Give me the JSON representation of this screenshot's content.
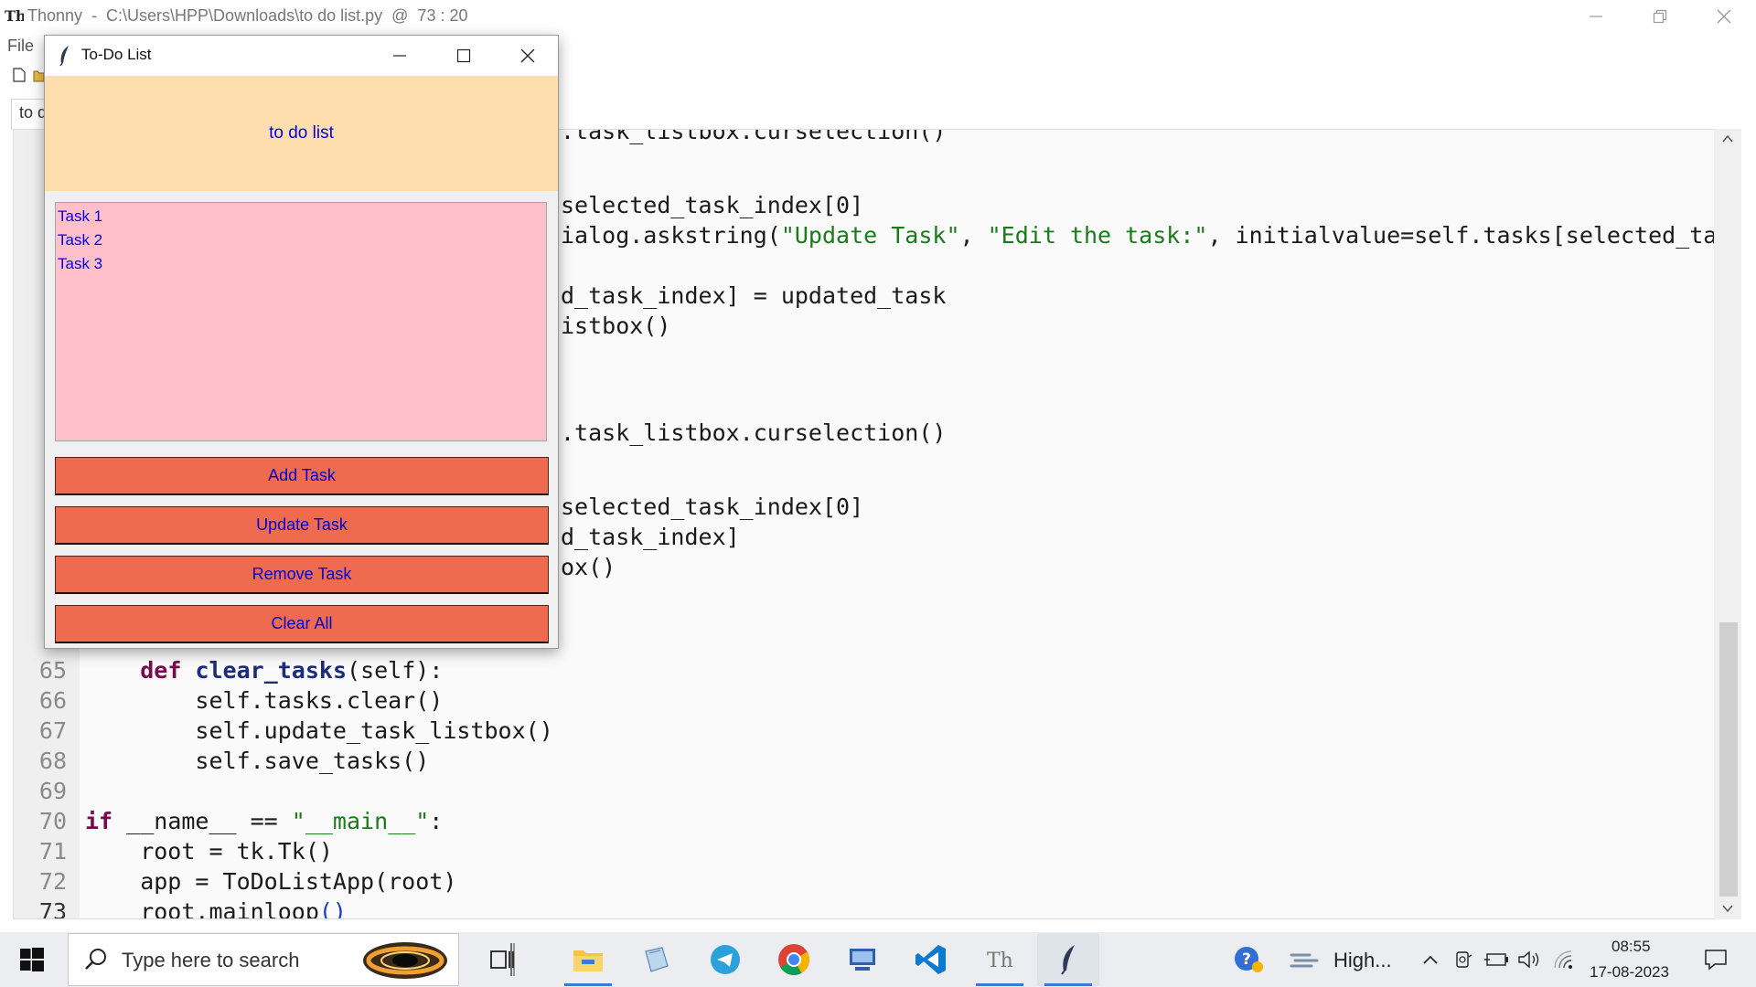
{
  "thonny": {
    "title": "Thonny  -  C:\\Users\\HPP\\Downloads\\to do list.py  @  73 : 20",
    "menu_file": "File",
    "tab_label": "to d"
  },
  "editor": {
    "visible_fragments": [
      ".task_listbox.curselection()",
      "selected_task_index[0]",
      "ialog.askstring(",
      "\"Update Task\"",
      "\"Edit the task:\"",
      ", initialvalue=self.tasks[selected_tas",
      "d_task_index] = updated_task",
      "istbox()",
      ".task_listbox.curselection()",
      "selected_task_index[0]",
      "d_task_index]",
      "ox()"
    ],
    "lines": [
      {
        "num": "65",
        "indent": "    ",
        "kw": "def",
        "fn": "clear_tasks",
        "rest": "(self):"
      },
      {
        "num": "66",
        "text": "        self.tasks.clear()"
      },
      {
        "num": "67",
        "text": "        self.update_task_listbox()"
      },
      {
        "num": "68",
        "text": "        self.save_tasks()"
      },
      {
        "num": "69",
        "text": ""
      },
      {
        "num": "70",
        "kw": "if",
        "mid": " __name__ == ",
        "str": "\"__main__\"",
        "rest": ":"
      },
      {
        "num": "71",
        "text": "    root = tk.Tk()"
      },
      {
        "num": "72",
        "text": "    app = ToDoListApp(root)"
      },
      {
        "num": "73",
        "text": "    root.mainloop",
        "paren": "()"
      }
    ]
  },
  "todo_window": {
    "title": "To-Do List",
    "header_label": "to do list",
    "tasks": [
      "Task 1",
      "Task 2",
      "Task 3"
    ],
    "buttons": {
      "add": "Add Task",
      "update": "Update Task",
      "remove": "Remove Task",
      "clear": "Clear All"
    },
    "colors": {
      "header_bg": "#ffdead",
      "listbox_bg": "#ffc0cb",
      "button_bg": "#ef6b50",
      "text": "#0000ee"
    }
  },
  "taskbar": {
    "search_placeholder": "Type here to search",
    "tray_label": "High...",
    "time": "08:55",
    "date": "17-08-2023",
    "icons": [
      "windows-start-icon",
      "search-icon",
      "task-view-icon",
      "file-explorer-icon",
      "notepad-icon",
      "telegram-icon",
      "chrome-icon",
      "remote-desktop-icon",
      "vscode-icon",
      "thonny-icon",
      "feather-icon",
      "help-icon",
      "weather-icon",
      "chevron-up-icon",
      "meet-icon",
      "battery-icon",
      "volume-icon",
      "wifi-icon",
      "notification-icon"
    ]
  }
}
